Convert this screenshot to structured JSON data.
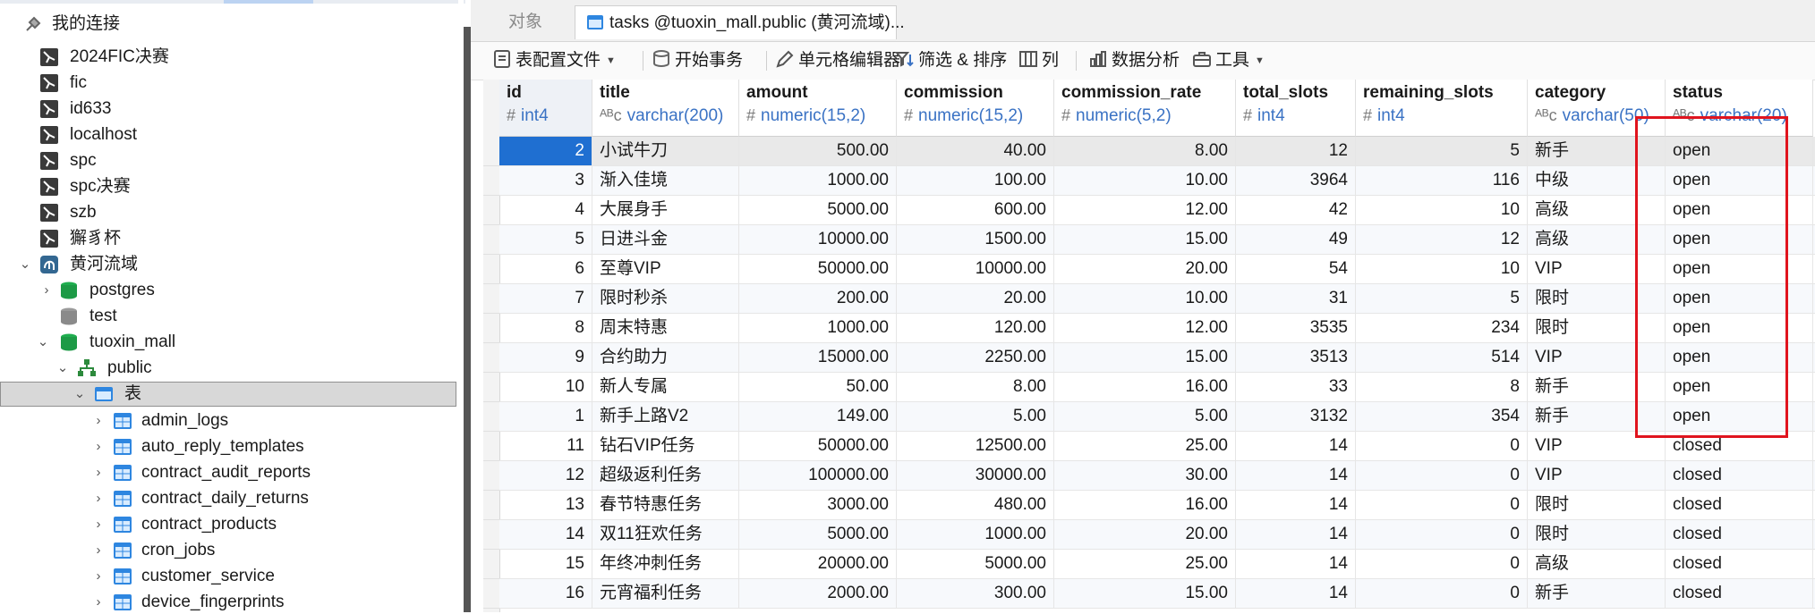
{
  "nav": {
    "root_label": "我的连接",
    "connections": [
      "2024FIC决赛",
      "fic",
      "id633",
      "localhost",
      "spc",
      "spc决赛",
      "szb",
      "獬豸杯"
    ],
    "open_connection": "黄河流域",
    "databases": [
      "postgres",
      "test"
    ],
    "open_database": "tuoxin_mall",
    "schema": "public",
    "tables_folder": "表",
    "tables": [
      "admin_logs",
      "auto_reply_templates",
      "contract_audit_reports",
      "contract_daily_returns",
      "contract_products",
      "cron_jobs",
      "customer_service",
      "device_fingerprints"
    ]
  },
  "tabs": {
    "objects": "对象",
    "active": "tasks @tuoxin_mall.public (黄河流域)..."
  },
  "toolbar": {
    "table_config": "表配置文件",
    "begin_transaction": "开始事务",
    "cell_editor": "单元格编辑器",
    "filter_sort": "筛选 & 排序",
    "columns": "列",
    "data_analysis": "数据分析",
    "tools": "工具"
  },
  "columns": [
    {
      "name": "id",
      "type": "int4",
      "glyph": "#"
    },
    {
      "name": "title",
      "type": "varchar(200)",
      "glyph": "ᴬᴮc"
    },
    {
      "name": "amount",
      "type": "numeric(15,2)",
      "glyph": "#"
    },
    {
      "name": "commission",
      "type": "numeric(15,2)",
      "glyph": "#"
    },
    {
      "name": "commission_rate",
      "type": "numeric(5,2)",
      "glyph": "#"
    },
    {
      "name": "total_slots",
      "type": "int4",
      "glyph": "#"
    },
    {
      "name": "remaining_slots",
      "type": "int4",
      "glyph": "#"
    },
    {
      "name": "category",
      "type": "varchar(50)",
      "glyph": "ᴬᴮc"
    },
    {
      "name": "status",
      "type": "varchar(20)",
      "glyph": "ᴬᴮc"
    }
  ],
  "rows": [
    [
      "2",
      "小试牛刀",
      "500.00",
      "40.00",
      "8.00",
      "12",
      "5",
      "新手",
      "open"
    ],
    [
      "3",
      "渐入佳境",
      "1000.00",
      "100.00",
      "10.00",
      "3964",
      "116",
      "中级",
      "open"
    ],
    [
      "4",
      "大展身手",
      "5000.00",
      "600.00",
      "12.00",
      "42",
      "10",
      "高级",
      "open"
    ],
    [
      "5",
      "日进斗金",
      "10000.00",
      "1500.00",
      "15.00",
      "49",
      "12",
      "高级",
      "open"
    ],
    [
      "6",
      "至尊VIP",
      "50000.00",
      "10000.00",
      "20.00",
      "54",
      "10",
      "VIP",
      "open"
    ],
    [
      "7",
      "限时秒杀",
      "200.00",
      "20.00",
      "10.00",
      "31",
      "5",
      "限时",
      "open"
    ],
    [
      "8",
      "周末特惠",
      "1000.00",
      "120.00",
      "12.00",
      "3535",
      "234",
      "限时",
      "open"
    ],
    [
      "9",
      "合约助力",
      "15000.00",
      "2250.00",
      "15.00",
      "3513",
      "514",
      "VIP",
      "open"
    ],
    [
      "10",
      "新人专属",
      "50.00",
      "8.00",
      "16.00",
      "33",
      "8",
      "新手",
      "open"
    ],
    [
      "1",
      "新手上路V2",
      "149.00",
      "5.00",
      "5.00",
      "3132",
      "354",
      "新手",
      "open"
    ],
    [
      "11",
      "钻石VIP任务",
      "50000.00",
      "12500.00",
      "25.00",
      "14",
      "0",
      "VIP",
      "closed"
    ],
    [
      "12",
      "超级返利任务",
      "100000.00",
      "30000.00",
      "30.00",
      "14",
      "0",
      "VIP",
      "closed"
    ],
    [
      "13",
      "春节特惠任务",
      "3000.00",
      "480.00",
      "16.00",
      "14",
      "0",
      "限时",
      "closed"
    ],
    [
      "14",
      "双11狂欢任务",
      "5000.00",
      "1000.00",
      "20.00",
      "14",
      "0",
      "限时",
      "closed"
    ],
    [
      "15",
      "年终冲刺任务",
      "20000.00",
      "5000.00",
      "25.00",
      "14",
      "0",
      "高级",
      "closed"
    ],
    [
      "16",
      "元宵福利任务",
      "2000.00",
      "300.00",
      "15.00",
      "14",
      "0",
      "新手",
      "closed"
    ]
  ],
  "colors": {
    "selection": "#1f6fd1",
    "highlight_box": "#e0141e",
    "type_text": "#3a72c4"
  }
}
